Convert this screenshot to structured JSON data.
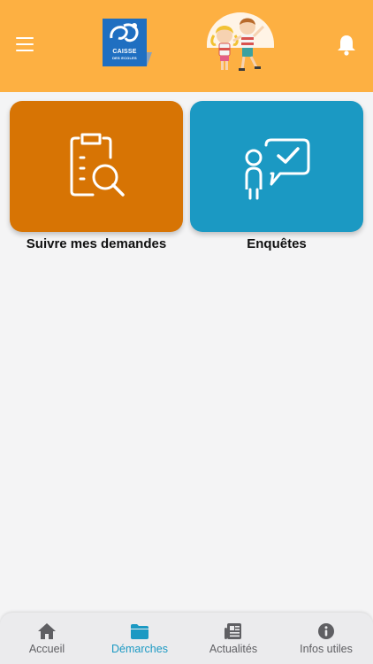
{
  "header": {
    "logo": {
      "line1": "CAISSE",
      "line2": "DES ECOLES",
      "mark": "CE"
    },
    "menu_icon": "hamburger-menu-icon",
    "notification_icon": "bell-icon",
    "mascot": "children-mascot-illustration"
  },
  "tiles": [
    {
      "label": "Suivre mes demandes",
      "icon": "clipboard-search-icon",
      "color": "#d77404"
    },
    {
      "label": "Enquêtes",
      "icon": "survey-check-icon",
      "color": "#1b99c3"
    }
  ],
  "tabbar": {
    "active_index": 1,
    "active_color": "#1b99c3",
    "tabs": [
      {
        "label": "Accueil",
        "icon": "home-icon"
      },
      {
        "label": "Démarches",
        "icon": "folder-icon"
      },
      {
        "label": "Actualités",
        "icon": "newspaper-icon"
      },
      {
        "label": "Infos utiles",
        "icon": "info-icon"
      }
    ]
  },
  "colors": {
    "header": "#fdb042",
    "background": "#f4f4f5",
    "tabbar": "#ebebed"
  }
}
